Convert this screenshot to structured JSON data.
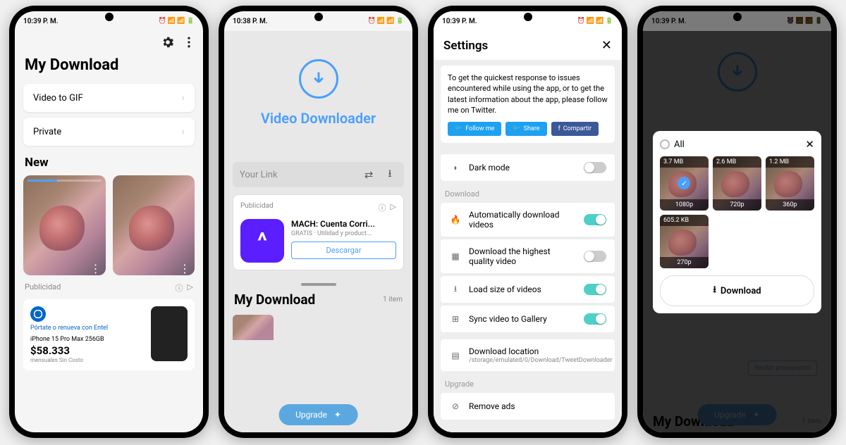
{
  "statusbar": {
    "time": "10:39 P. M.",
    "time2": "10:38 P. M."
  },
  "s1": {
    "title": "My Download",
    "menu1": "Video to GIF",
    "menu2": "Private",
    "new": "New",
    "ad_label": "Publicidad",
    "ad_brand": "Pórtate o renueva con Entel",
    "ad_product": "iPhone 15 Pro Max 256GB",
    "ad_price": "$58.333",
    "ad_note": "mensuales Sin Costo"
  },
  "s2": {
    "app_title": "Video Downloader",
    "placeholder": "Your Link",
    "ad_label": "Publicidad",
    "ad_title": "MACH: Cuenta Corri...",
    "ad_sub": "GRATIS · Utilidad y product...",
    "ad_btn": "Descargar",
    "section": "My Download",
    "count": "1 item",
    "upgrade": "Upgrade"
  },
  "s3": {
    "title": "Settings",
    "info": "To get the quickest response to issues encountered while using the app, or to get the latest information about the app, please follow me on Twitter.",
    "follow": "Follow me",
    "share": "Share",
    "compartir": "Compartir",
    "dark": "Dark mode",
    "group_dl": "Download",
    "auto": "Automatically download videos",
    "hq": "Download the highest quality video",
    "load": "Load size of videos",
    "sync": "Sync video to Gallery",
    "loc_label": "Download location",
    "loc_path": "/storage/emulated/0/Download/TweetDownloader",
    "group_up": "Upgrade",
    "remove": "Remove ads"
  },
  "s4": {
    "all": "All",
    "items": [
      {
        "size": "3.7 MB",
        "res": "1080p",
        "selected": true
      },
      {
        "size": "2.6 MB",
        "res": "720p",
        "selected": false
      },
      {
        "size": "1.2 MB",
        "res": "360p",
        "selected": false
      },
      {
        "size": "605.2 KB",
        "res": "270p",
        "selected": false
      }
    ],
    "download": "Download",
    "ghost": "Recibir presupuesto",
    "section": "My Download",
    "count": "1 item",
    "upgrade": "Upgrade"
  }
}
